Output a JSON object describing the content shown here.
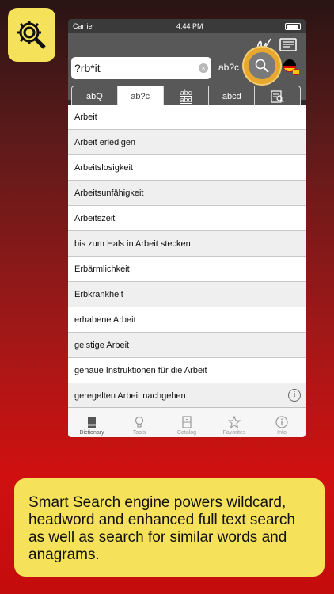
{
  "status": {
    "carrier": "Carrier",
    "time": "4:44 PM"
  },
  "search": {
    "query": "?rb*it",
    "mode_label": "ab?c"
  },
  "segments": [
    {
      "label": "ab",
      "suffix": "Q"
    },
    {
      "label": "ab?c"
    },
    {
      "top": "abc",
      "bottom": "abd"
    },
    {
      "label": "abcd"
    },
    {
      "label": ""
    }
  ],
  "results": [
    "Arbeit",
    "Arbeit erledigen",
    "Arbeitslosigkeit",
    "Arbeitsunfähigkeit",
    "Arbeitszeit",
    "bis zum Hals in Arbeit stecken",
    "Erbärmlichkeit",
    "Erbkrankheit",
    "erhabene Arbeit",
    "geistige Arbeit",
    "genaue Instruktionen für die Arbeit",
    "geregelten Arbeit nachgehen"
  ],
  "info_symbol": "i",
  "tabs": [
    {
      "label": "Dictionary",
      "icon": "book-icon"
    },
    {
      "label": "Tools",
      "icon": "lightbulb-icon"
    },
    {
      "label": "Catalog",
      "icon": "cabinet-icon"
    },
    {
      "label": "Favorites",
      "icon": "star-icon"
    },
    {
      "label": "Info",
      "icon": "info-icon"
    }
  ],
  "caption": "Smart Search engine powers wildcard, headword and enhanced full text search as well as search for similar words and anagrams.",
  "colors": {
    "accent_yellow": "#f6e25a",
    "search_orange": "#e8a830"
  }
}
